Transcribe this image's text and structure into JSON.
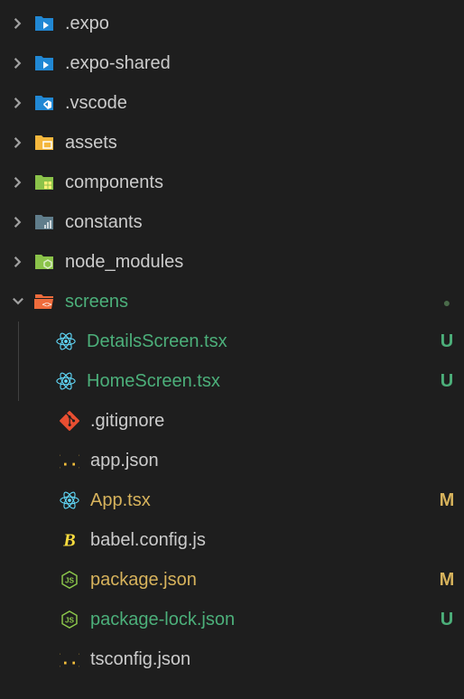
{
  "tree": [
    {
      "name": ".expo",
      "type": "folder",
      "expanded": false,
      "icon": "folder-expo",
      "depth": 1,
      "color": "default",
      "badge": ""
    },
    {
      "name": ".expo-shared",
      "type": "folder",
      "expanded": false,
      "icon": "folder-expo",
      "depth": 1,
      "color": "default",
      "badge": ""
    },
    {
      "name": ".vscode",
      "type": "folder",
      "expanded": false,
      "icon": "folder-vscode",
      "depth": 1,
      "color": "default",
      "badge": ""
    },
    {
      "name": "assets",
      "type": "folder",
      "expanded": false,
      "icon": "folder-assets",
      "depth": 1,
      "color": "default",
      "badge": ""
    },
    {
      "name": "components",
      "type": "folder",
      "expanded": false,
      "icon": "folder-components",
      "depth": 1,
      "color": "default",
      "badge": ""
    },
    {
      "name": "constants",
      "type": "folder",
      "expanded": false,
      "icon": "folder-constants",
      "depth": 1,
      "color": "default",
      "badge": ""
    },
    {
      "name": "node_modules",
      "type": "folder",
      "expanded": false,
      "icon": "folder-node",
      "depth": 1,
      "color": "default",
      "badge": ""
    },
    {
      "name": "screens",
      "type": "folder",
      "expanded": true,
      "icon": "folder-screens",
      "depth": 1,
      "color": "green",
      "badge": "dot"
    },
    {
      "name": "DetailsScreen.tsx",
      "type": "file",
      "icon": "react",
      "depth": 2,
      "color": "green",
      "badge": "U"
    },
    {
      "name": "HomeScreen.tsx",
      "type": "file",
      "icon": "react",
      "depth": 2,
      "color": "green",
      "badge": "U"
    },
    {
      "name": ".gitignore",
      "type": "file",
      "icon": "git",
      "depth": 1,
      "color": "default",
      "badge": ""
    },
    {
      "name": "app.json",
      "type": "file",
      "icon": "json",
      "depth": 1,
      "color": "default",
      "badge": ""
    },
    {
      "name": "App.tsx",
      "type": "file",
      "icon": "react",
      "depth": 1,
      "color": "modified",
      "badge": "M"
    },
    {
      "name": "babel.config.js",
      "type": "file",
      "icon": "babel",
      "depth": 1,
      "color": "default",
      "badge": ""
    },
    {
      "name": "package.json",
      "type": "file",
      "icon": "nodejs",
      "depth": 1,
      "color": "modified",
      "badge": "M"
    },
    {
      "name": "package-lock.json",
      "type": "file",
      "icon": "nodejs",
      "depth": 1,
      "color": "untracked",
      "badge": "U"
    },
    {
      "name": "tsconfig.json",
      "type": "file",
      "icon": "json",
      "depth": 1,
      "color": "default",
      "badge": ""
    }
  ]
}
